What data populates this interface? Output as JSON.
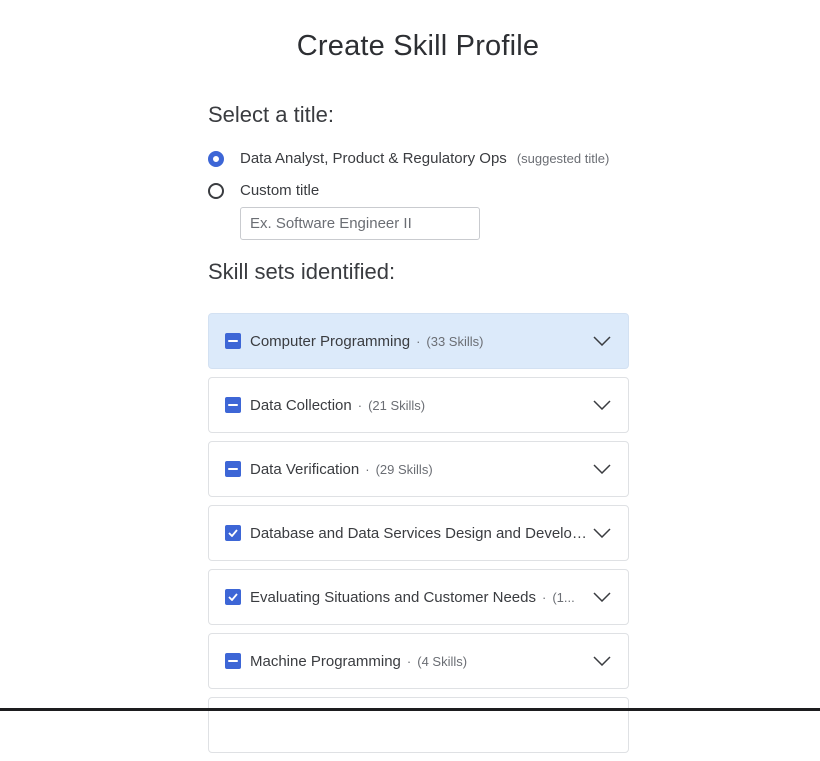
{
  "page": {
    "title": "Create Skill Profile"
  },
  "title_section": {
    "heading": "Select a title:",
    "options": [
      {
        "label": "Data Analyst, Product & Regulatory Ops",
        "note": "(suggested title)",
        "selected": true
      },
      {
        "label": "Custom title",
        "note": "",
        "selected": false
      }
    ],
    "custom_input": {
      "value": "",
      "placeholder": "Ex. Software Engineer II"
    }
  },
  "skills_section": {
    "heading": "Skill sets identified:",
    "separator": "·",
    "items": [
      {
        "name": "Computer Programming",
        "count": "(33 Skills)",
        "state": "partial",
        "highlighted": true,
        "truncated": false
      },
      {
        "name": "Data Collection",
        "count": "(21 Skills)",
        "state": "partial",
        "highlighted": false,
        "truncated": false
      },
      {
        "name": "Data Verification",
        "count": "(29 Skills)",
        "state": "partial",
        "highlighted": false,
        "truncated": false
      },
      {
        "name": "Database and Data Services Design and Development",
        "count": "",
        "state": "checked",
        "highlighted": false,
        "truncated": true
      },
      {
        "name": "Evaluating Situations and Customer Needs",
        "count": "(1...",
        "state": "checked",
        "highlighted": false,
        "truncated": true
      },
      {
        "name": "Machine Programming",
        "count": "(4 Skills)",
        "state": "partial",
        "highlighted": false,
        "truncated": false
      }
    ]
  },
  "colors": {
    "accent": "#3d66d6",
    "highlight_bg": "#dceafa",
    "text": "#3a3c40",
    "muted": "#6b6e74"
  }
}
